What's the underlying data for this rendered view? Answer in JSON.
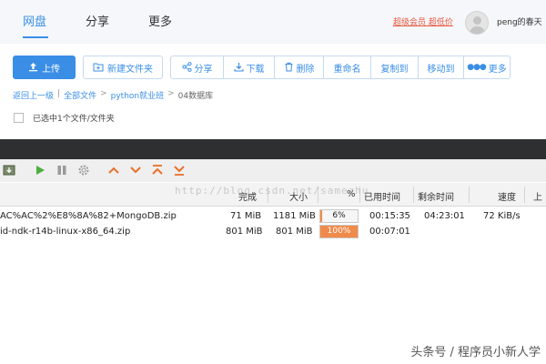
{
  "nav": {
    "tabs": [
      {
        "label": "网盘",
        "active": true
      },
      {
        "label": "分享",
        "active": false
      },
      {
        "label": "更多",
        "active": false
      }
    ],
    "vip_label": "超级会员 超低价",
    "username": "peng的春天"
  },
  "toolbar": {
    "upload": "上传",
    "new_folder": "新建文件夹",
    "share": "分享",
    "download": "下载",
    "delete": "删除",
    "rename": "重命名",
    "copy_to": "复制到",
    "move_to": "移动到",
    "more": "更多"
  },
  "breadcrumb": {
    "back": "返回上一级",
    "all_files": "全部文件",
    "folder": "python就业班",
    "current": "04数据库"
  },
  "selection": {
    "status": "已选中1个文件/文件夹"
  },
  "download_manager": {
    "columns": {
      "done": "完成",
      "size": "大小",
      "percent": "%",
      "elapsed": "已用时间",
      "remaining": "剩余时间",
      "speed": "速度",
      "upload": "上"
    },
    "rows": [
      {
        "name": "AC%AC%2%E8%8A%82+MongoDB.zip",
        "done": "71 MiB",
        "size": "1181 MiB",
        "percent_label": "6%",
        "progress": 0.06,
        "elapsed": "00:15:35",
        "remaining": "04:23:01",
        "speed": "72 KiB/s"
      },
      {
        "name": "id-ndk-r14b-linux-x86_64.zip",
        "done": "801 MiB",
        "size": "801 MiB",
        "percent_label": "100%",
        "progress": 1.0,
        "elapsed": "00:07:01",
        "remaining": "",
        "speed": ""
      }
    ]
  },
  "watermarks": {
    "url": "http://blog.csdn.net/samezhu",
    "source": "头条号 / 程序员小新人学"
  },
  "colors": {
    "accent": "#3a8ee6",
    "progress_fill": "#f08a4b",
    "vip": "#e8563d",
    "dark_bar": "#2e2f30"
  }
}
